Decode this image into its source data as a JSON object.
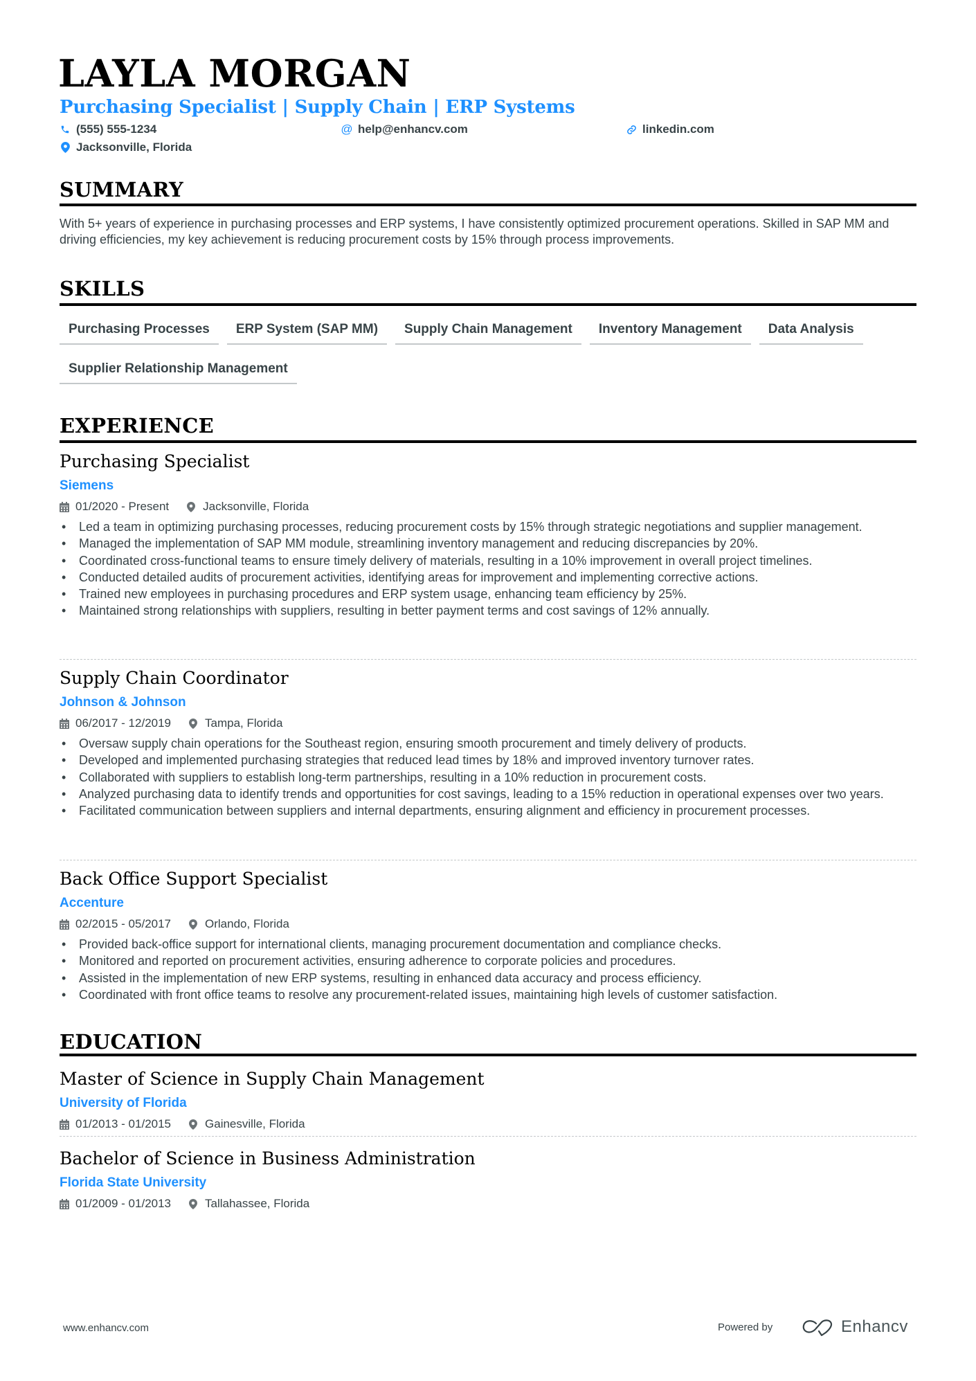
{
  "header": {
    "name": "LAYLA MORGAN",
    "title": "Purchasing Specialist | Supply Chain | ERP Systems",
    "contacts": {
      "phone": {
        "icon": "phone-icon",
        "text": "(555) 555-1234"
      },
      "email": {
        "icon": "at-icon",
        "text": "help@enhancv.com"
      },
      "website": {
        "icon": "link-icon",
        "text": "linkedin.com"
      },
      "location": {
        "icon": "map-pin-icon",
        "text": "Jacksonville, Florida"
      }
    }
  },
  "colors": {
    "accent": "#1e90ff",
    "text": "#384347",
    "heading": "#000000"
  },
  "summary": {
    "heading": "SUMMARY",
    "text": "With 5+ years of experience in purchasing processes and ERP systems, I have consistently optimized procurement operations. Skilled in SAP MM and driving efficiencies, my key achievement is reducing procurement costs by 15% through process improvements."
  },
  "skills": {
    "heading": "SKILLS",
    "items": [
      "Purchasing Processes",
      "ERP System (SAP MM)",
      "Supply Chain Management",
      "Inventory Management",
      "Data Analysis",
      "Supplier Relationship Management"
    ]
  },
  "experience": {
    "heading": "EXPERIENCE",
    "jobs": [
      {
        "title": "Purchasing Specialist",
        "company": "Siemens",
        "dates": "01/2020 - Present",
        "location": "Jacksonville, Florida",
        "bullets": [
          "Led a team in optimizing purchasing processes, reducing procurement costs by 15% through strategic negotiations and supplier management.",
          "Managed the implementation of SAP MM module, streamlining inventory management and reducing discrepancies by 20%.",
          "Coordinated cross-functional teams to ensure timely delivery of materials, resulting in a 10% improvement in overall project timelines.",
          "Conducted detailed audits of procurement activities, identifying areas for improvement and implementing corrective actions.",
          "Trained new employees in purchasing procedures and ERP system usage, enhancing team efficiency by 25%.",
          "Maintained strong relationships with suppliers, resulting in better payment terms and cost savings of 12% annually."
        ]
      },
      {
        "title": "Supply Chain Coordinator",
        "company": "Johnson & Johnson",
        "dates": "06/2017 - 12/2019",
        "location": "Tampa, Florida",
        "bullets": [
          "Oversaw supply chain operations for the Southeast region, ensuring smooth procurement and timely delivery of products.",
          "Developed and implemented purchasing strategies that reduced lead times by 18% and improved inventory turnover rates.",
          "Collaborated with suppliers to establish long-term partnerships, resulting in a 10% reduction in procurement costs.",
          "Analyzed purchasing data to identify trends and opportunities for cost savings, leading to a 15% reduction in operational expenses over two years.",
          "Facilitated communication between suppliers and internal departments, ensuring alignment and efficiency in procurement processes."
        ]
      },
      {
        "title": "Back Office Support Specialist",
        "company": "Accenture",
        "dates": "02/2015 - 05/2017",
        "location": "Orlando, Florida",
        "bullets": [
          "Provided back-office support for international clients, managing procurement documentation and compliance checks.",
          "Monitored and reported on procurement activities, ensuring adherence to corporate policies and procedures.",
          "Assisted in the implementation of new ERP systems, resulting in enhanced data accuracy and process efficiency.",
          "Coordinated with front office teams to resolve any procurement-related issues, maintaining high levels of customer satisfaction."
        ]
      }
    ]
  },
  "education": {
    "heading": "EDUCATION",
    "items": [
      {
        "degree": "Master of Science in Supply Chain Management",
        "school": "University of Florida",
        "dates": "01/2013 - 01/2015",
        "location": "Gainesville, Florida"
      },
      {
        "degree": "Bachelor of Science in Business Administration",
        "school": "Florida State University",
        "dates": "01/2009 - 01/2013",
        "location": "Tallahassee, Florida"
      }
    ]
  },
  "footer": {
    "website": "www.enhancv.com",
    "powered_by": "Powered by",
    "brand": "Enhancv"
  }
}
